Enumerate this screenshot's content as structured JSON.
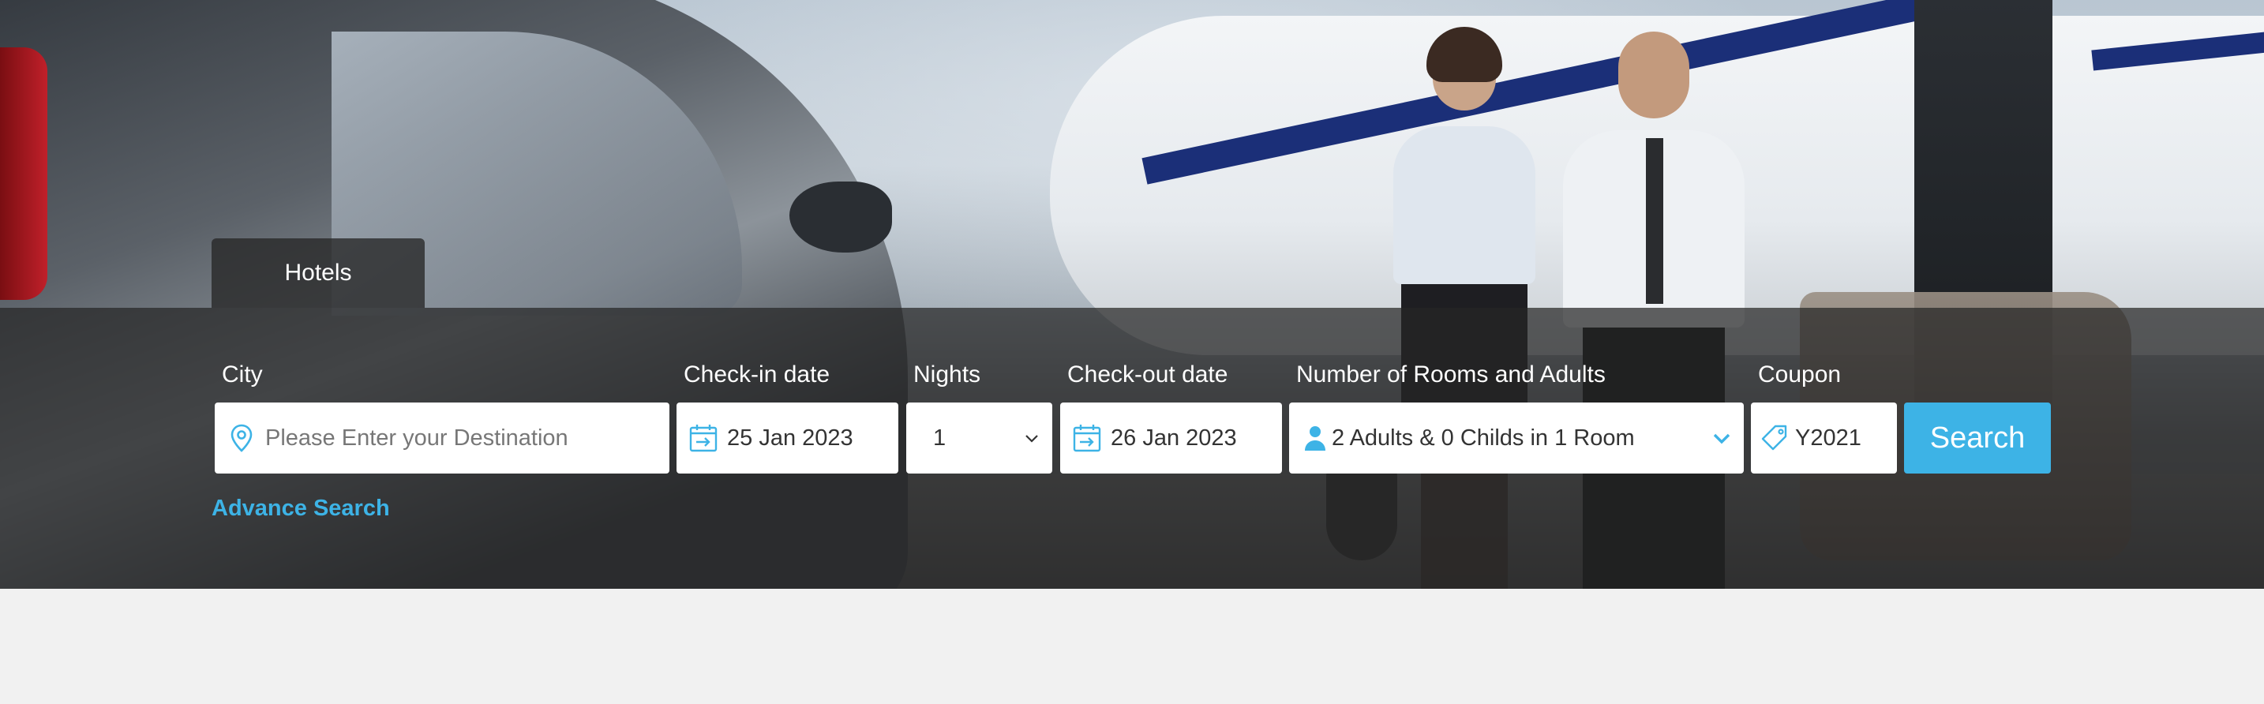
{
  "tabs": [
    {
      "label": "Hotels",
      "active": true
    }
  ],
  "search_form": {
    "city": {
      "label": "City",
      "placeholder": "Please Enter your Destination",
      "icon": "location-pin-icon"
    },
    "checkin": {
      "label": "Check-in date",
      "value": "25 Jan 2023",
      "icon": "calendar-icon"
    },
    "nights": {
      "label": "Nights",
      "value": "1",
      "icon": "chevron-down-icon"
    },
    "checkout": {
      "label": "Check-out date",
      "value": "26 Jan 2023",
      "icon": "calendar-icon"
    },
    "rooms": {
      "label": "Number of Rooms and Adults",
      "value": "2 Adults & 0 Childs in 1 Room",
      "icon": "user-icon"
    },
    "coupon": {
      "label": "Coupon",
      "value": "Y2021",
      "icon": "tag-icon"
    },
    "search_button": "Search",
    "advance_search": "Advance Search"
  },
  "colors": {
    "accent": "#3db3e6",
    "overlay": "#262626",
    "page_bg": "#f1f1f1"
  }
}
